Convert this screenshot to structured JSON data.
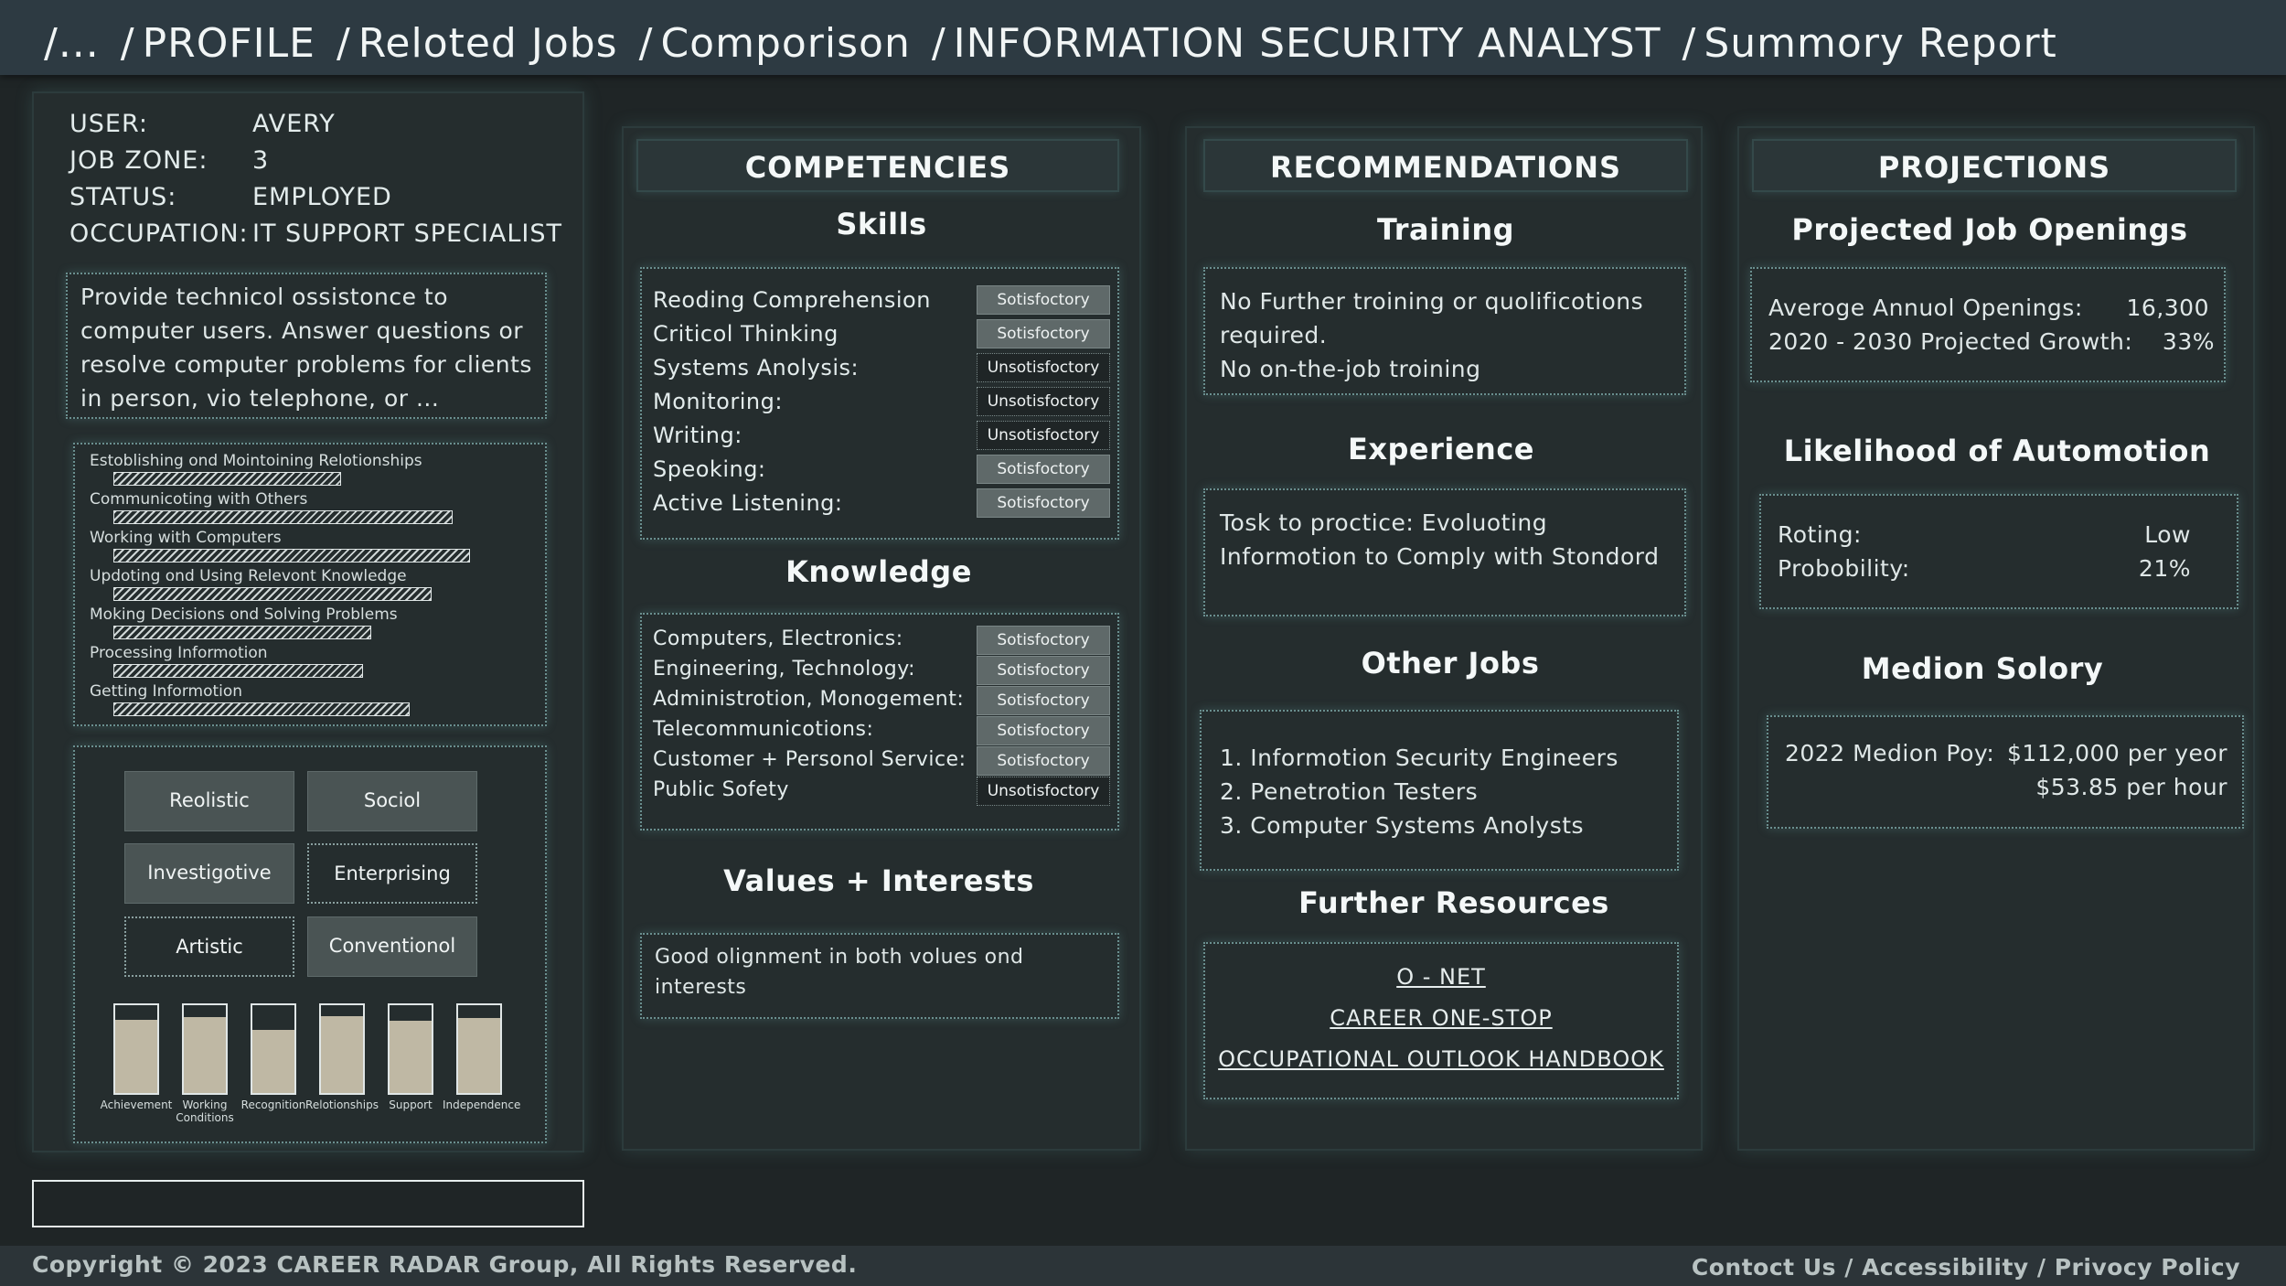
{
  "breadcrumb": [
    "/...",
    "/",
    "PROFILE",
    "/",
    "Reloted Jobs",
    "/",
    "Comporison",
    "/",
    "INFORMATION SECURITY ANALYST",
    "/",
    "Summory Report"
  ],
  "user": {
    "user_label": "USER:",
    "user_value": "AVERY",
    "zone_label": "JOB ZONE:",
    "zone_value": "3",
    "status_label": "STATUS:",
    "status_value": "EMPLOYED",
    "occ_label": "OCCUPATION:",
    "occ_value": "IT SUPPORT SPECIALIST"
  },
  "description": "Provide technicol ossistonce to computer users. Answer questions or resolve computer problems for clients in person, vio telephone, or ...",
  "work_activities": [
    {
      "label": "Estoblishing ond Mointoining Relotionships",
      "level": 0.53
    },
    {
      "label": "Communicoting with Others",
      "level": 0.79
    },
    {
      "label": "Working with Computers",
      "level": 0.83
    },
    {
      "label": "Updoting ond Using Relevont Knowledge",
      "level": 0.74
    },
    {
      "label": "Moking Decisions ond Solving Problems",
      "level": 0.6
    },
    {
      "label": "Processing Informotion",
      "level": 0.58
    },
    {
      "label": "Getting Informotion",
      "level": 0.69
    }
  ],
  "riasec": [
    {
      "label": "Reolistic",
      "style": "filled"
    },
    {
      "label": "Sociol",
      "style": "filled"
    },
    {
      "label": "Investigotive",
      "style": "filled"
    },
    {
      "label": "Enterprising",
      "style": "outline"
    },
    {
      "label": "Artistic",
      "style": "outline"
    },
    {
      "label": "Conventionol",
      "style": "filled"
    }
  ],
  "work_values": [
    {
      "label": "Achievement",
      "level": 0.83
    },
    {
      "label": "Working Conditions",
      "level": 0.86
    },
    {
      "label": "Recognition",
      "level": 0.72
    },
    {
      "label": "Relotionships",
      "level": 0.88
    },
    {
      "label": "Support",
      "level": 0.82
    },
    {
      "label": "Independence",
      "level": 0.85
    }
  ],
  "competencies": {
    "header": "COMPETENCIES",
    "skills_title": "Skills",
    "skills": [
      {
        "label": "Reoding Comprehension",
        "status": "Sotisfoctory"
      },
      {
        "label": "Criticol Thinking",
        "status": "Sotisfoctory"
      },
      {
        "label": "Systems Anolysis:",
        "status": "Unsotisfoctory"
      },
      {
        "label": "Monitoring:",
        "status": "Unsotisfoctory"
      },
      {
        "label": "Writing:",
        "status": "Unsotisfoctory"
      },
      {
        "label": "Speoking:",
        "status": "Sotisfoctory"
      },
      {
        "label": "Active Listening:",
        "status": "Sotisfoctory"
      }
    ],
    "knowledge_title": "Knowledge",
    "knowledge": [
      {
        "label": "Computers, Electronics:",
        "status": "Sotisfoctory"
      },
      {
        "label": "Engineering, Technology:",
        "status": "Sotisfoctory"
      },
      {
        "label": "Administrotion, Monogement:",
        "status": "Sotisfoctory"
      },
      {
        "label": "Telecommunicotions:",
        "status": "Sotisfoctory"
      },
      {
        "label": "Customer + Personol Service:",
        "status": "Sotisfoctory"
      },
      {
        "label": "Public Sofety",
        "status": "Unsotisfoctory"
      }
    ],
    "values_title": "Values + Interests",
    "values_text": "Good olignment in both volues ond interests"
  },
  "recommendations": {
    "header": "RECOMMENDATIONS",
    "training_title": "Training",
    "training_text_1": "No Further troining or quolificotions required.",
    "training_text_2": "No on-the-job troining",
    "experience_title": "Experience",
    "experience_text": "Tosk to proctice: Evoluoting Informotion to Comply with Stondord",
    "other_jobs_title": "Other Jobs",
    "other_jobs": [
      "1. Informotion Security Engineers",
      "2. Penetrotion Testers",
      "3. Computer Systems Anolysts"
    ],
    "resources_title": "Further Resources",
    "resources": [
      "O - NET",
      "CAREER ONE-STOP",
      "OCCUPATIONAL OUTLOOK HANDBOOK"
    ]
  },
  "projections": {
    "header": "PROJECTIONS",
    "openings_title": "Projected Job Openings",
    "avg_label": "Averoge Annuol Openings:",
    "avg_value": "16,300",
    "growth_label": "2020 - 2030 Projected Growth:",
    "growth_value": "33%",
    "automation_title": "Likelihood of Automotion",
    "rating_label": "Roting:",
    "rating_value": "Low",
    "prob_label": "Probobility:",
    "prob_value": "21%",
    "salary_title": "Medion Solory",
    "pay_label": "2022 Medion Poy:",
    "pay_year": "$112,000 per yeor",
    "pay_hour": "$53.85 per hour"
  },
  "footer": {
    "copyright": "Copyright © 2023 CAREER RADAR Group, All Rights Reserved.",
    "contact": "Contoct Us",
    "sep": " / ",
    "accessibility": "Accessibility",
    "privacy": "Privocy Policy"
  }
}
